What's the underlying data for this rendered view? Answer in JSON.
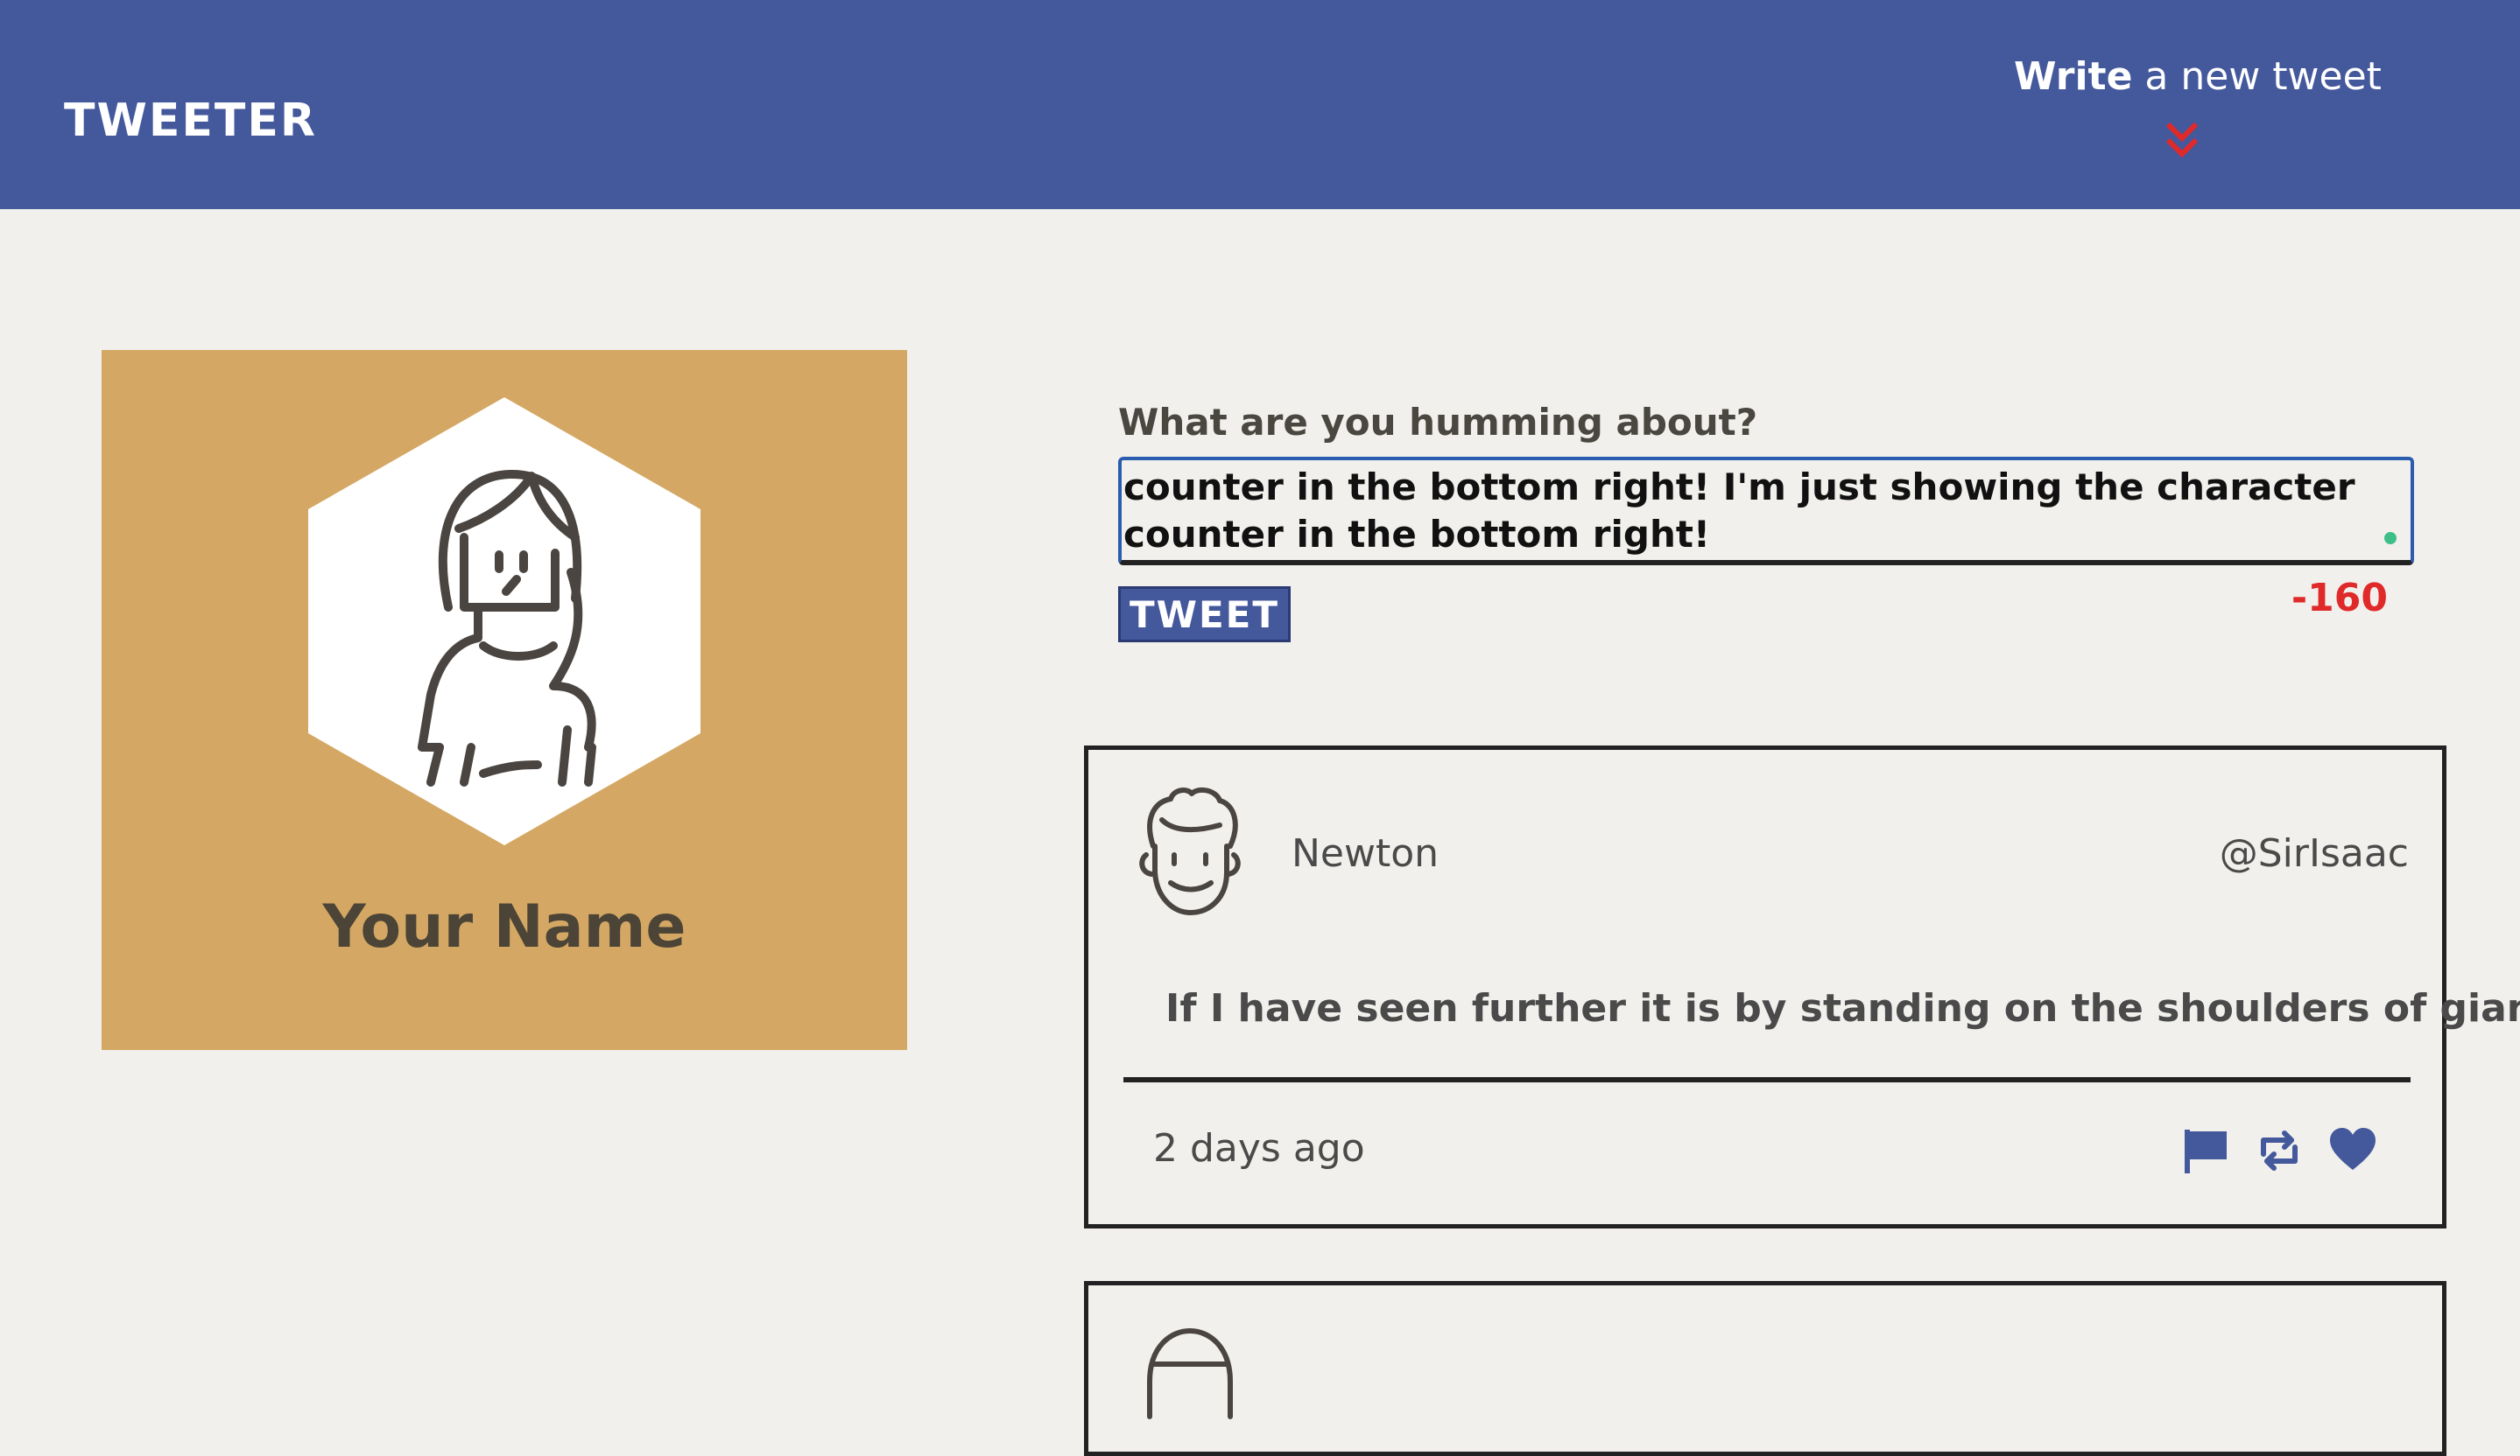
{
  "nav": {
    "brand": "TWEETER",
    "compose_toggle": {
      "bold": "Write",
      "rest": " a new tweet"
    }
  },
  "profile": {
    "name": "Your Name"
  },
  "composer": {
    "label": "What are you humming about?",
    "value": "counter in the bottom right! I'm just showing the character counter in the bottom right! ",
    "button": "TWEET",
    "counter": "-160"
  },
  "tweets": [
    {
      "name": "Newton",
      "handle": "@SirIsaac",
      "text": "If I have seen further it is by standing on the shoulders of giants",
      "time": "2 days ago",
      "actions": [
        "flag-icon",
        "retweet-icon",
        "heart-icon"
      ]
    }
  ],
  "colors": {
    "nav": "#44589c",
    "profile_bg": "#d4a864",
    "counter": "#e02a2a",
    "chevron": "#e02a2a"
  }
}
